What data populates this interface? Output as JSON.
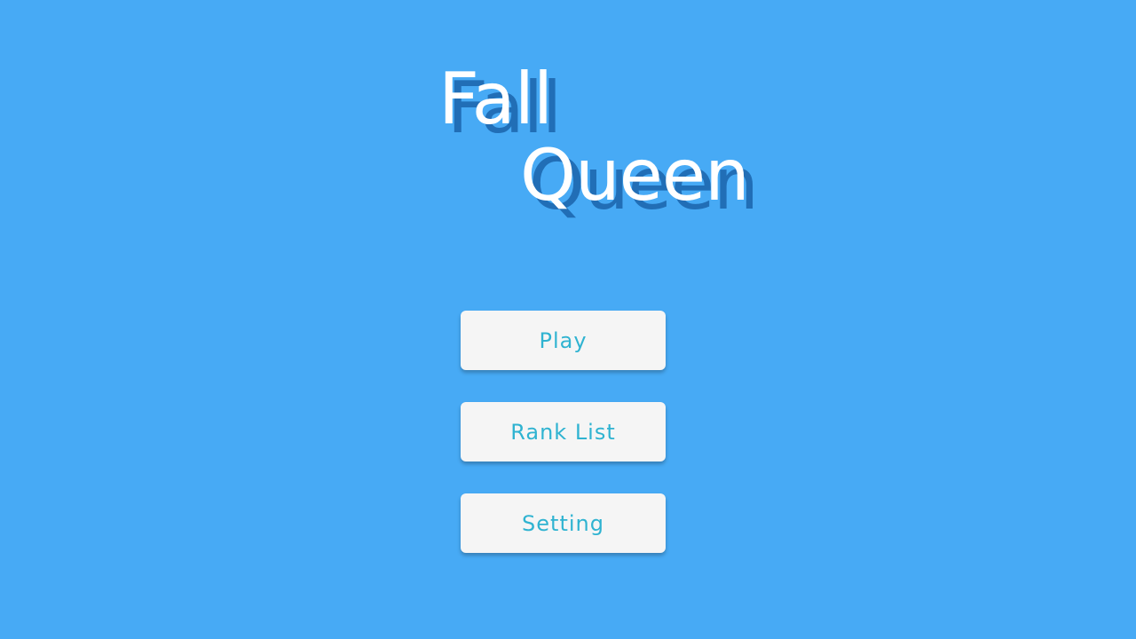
{
  "title": {
    "line1": "Fall",
    "line2": "Queen"
  },
  "menu": {
    "play_label": "Play",
    "rank_list_label": "Rank List",
    "setting_label": "Setting"
  },
  "colors": {
    "background": "#47aaf5",
    "button_background": "#f5f5f5",
    "button_text": "#2fb3d1",
    "title_text": "#ffffff"
  }
}
